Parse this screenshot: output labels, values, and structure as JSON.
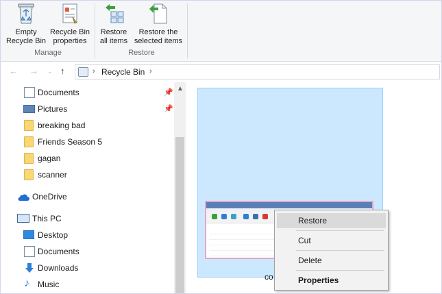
{
  "ribbon": {
    "groups": [
      {
        "label": "Manage",
        "buttons": [
          {
            "label": "Empty\nRecycle Bin",
            "icon": "recycle-bin-icon"
          },
          {
            "label": "Recycle Bin\nproperties",
            "icon": "properties-icon"
          }
        ]
      },
      {
        "label": "Restore",
        "buttons": [
          {
            "label": "Restore\nall items",
            "icon": "restore-all-icon"
          },
          {
            "label": "Restore the\nselected items",
            "icon": "restore-selected-icon"
          }
        ]
      }
    ]
  },
  "addressbar": {
    "back_icon": "back-arrow-icon",
    "forward_icon": "forward-arrow-icon",
    "recent_icon": "chevron-down-icon",
    "up_icon": "up-arrow-icon",
    "location_icon": "recycle-bin-icon",
    "path": "Recycle Bin"
  },
  "navpane": {
    "items": [
      {
        "label": "Documents",
        "icon": "documents-icon",
        "pinned": true
      },
      {
        "label": "Pictures",
        "icon": "pictures-icon",
        "pinned": true
      },
      {
        "label": "breaking bad",
        "icon": "folder-icon"
      },
      {
        "label": "Friends Season 5",
        "icon": "folder-icon"
      },
      {
        "label": "gagan",
        "icon": "folder-icon"
      },
      {
        "label": "scanner",
        "icon": "folder-icon"
      },
      {
        "label": "OneDrive",
        "icon": "onedrive-icon"
      },
      {
        "label": "This PC",
        "icon": "this-pc-icon"
      },
      {
        "label": "Desktop",
        "icon": "desktop-icon"
      },
      {
        "label": "Documents",
        "icon": "documents-icon"
      },
      {
        "label": "Downloads",
        "icon": "downloads-icon"
      },
      {
        "label": "Music",
        "icon": "music-icon"
      }
    ]
  },
  "content": {
    "selected_item_caption": "co"
  },
  "context_menu": {
    "items": [
      {
        "label": "Restore",
        "highlighted": true
      },
      {
        "label": "Cut"
      },
      {
        "label": "Delete"
      },
      {
        "label": "Properties",
        "bold": true
      }
    ]
  },
  "colors": {
    "ribbon_bg": "#f5f6f7",
    "selection_bg": "#cce8ff",
    "selection_border": "#99d1ff",
    "menu_bg": "#f2f2f2",
    "menu_hover": "#dadada",
    "folder": "#f8d775"
  }
}
